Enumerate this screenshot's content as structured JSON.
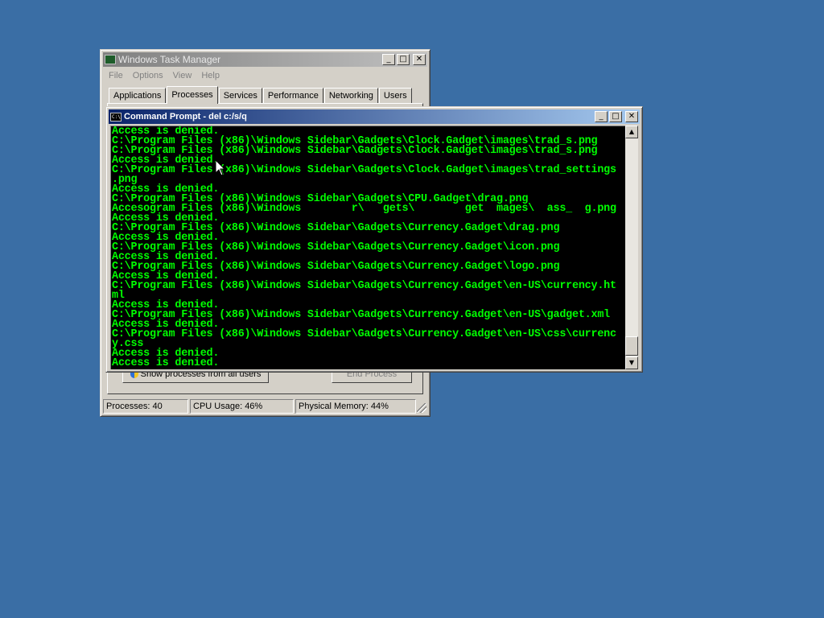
{
  "task_manager": {
    "title": "Windows Task Manager",
    "menu": [
      "File",
      "Options",
      "View",
      "Help"
    ],
    "tabs": [
      "Applications",
      "Processes",
      "Services",
      "Performance",
      "Networking",
      "Users"
    ],
    "selected_tab": "Processes",
    "show_all_button": "Show processes from all users",
    "end_process_button": "End Process",
    "status": {
      "processes": "Processes: 40",
      "cpu": "CPU Usage: 46%",
      "memory": "Physical Memory: 44%"
    }
  },
  "command_prompt": {
    "title": "Command Prompt - del  c:/s/q",
    "lines": [
      "Access is denied.",
      "C:\\Program Files (x86)\\Windows Sidebar\\Gadgets\\Clock.Gadget\\images\\trad_s.png",
      "C:\\Program Files (x86)\\Windows Sidebar\\Gadgets\\Clock.Gadget\\images\\trad_s.png",
      "Access is denied.",
      "C:\\Program Files (x86)\\Windows Sidebar\\Gadgets\\Clock.Gadget\\images\\trad_settings",
      ".png",
      "Access is denied.",
      "C:\\Program Files (x86)\\Windows Sidebar\\Gadgets\\CPU.Gadget\\drag.png",
      "Accesogram Files (x86)\\Windows        r\\   gets\\        get  mages\\  ass_  g.png",
      "Access is denied.",
      "C:\\Program Files (x86)\\Windows Sidebar\\Gadgets\\Currency.Gadget\\drag.png",
      "Access is denied.",
      "C:\\Program Files (x86)\\Windows Sidebar\\Gadgets\\Currency.Gadget\\icon.png",
      "Access is denied.",
      "C:\\Program Files (x86)\\Windows Sidebar\\Gadgets\\Currency.Gadget\\logo.png",
      "Access is denied.",
      "C:\\Program Files (x86)\\Windows Sidebar\\Gadgets\\Currency.Gadget\\en-US\\currency.ht",
      "ml",
      "Access is denied.",
      "C:\\Program Files (x86)\\Windows Sidebar\\Gadgets\\Currency.Gadget\\en-US\\gadget.xml",
      "Access is denied.",
      "C:\\Program Files (x86)\\Windows Sidebar\\Gadgets\\Currency.Gadget\\en-US\\css\\currenc",
      "y.css",
      "Access is denied.",
      "Access is denied."
    ]
  },
  "colors": {
    "desktop": "#3a6ea5",
    "console_text": "#00ff00",
    "console_bg": "#000000"
  },
  "icons": {
    "minimize": "minimize-icon",
    "maximize": "maximize-icon",
    "close": "close-icon",
    "scroll_up": "scroll-up-icon",
    "scroll_down": "scroll-down-icon",
    "cursor": "mouse-pointer-icon"
  }
}
